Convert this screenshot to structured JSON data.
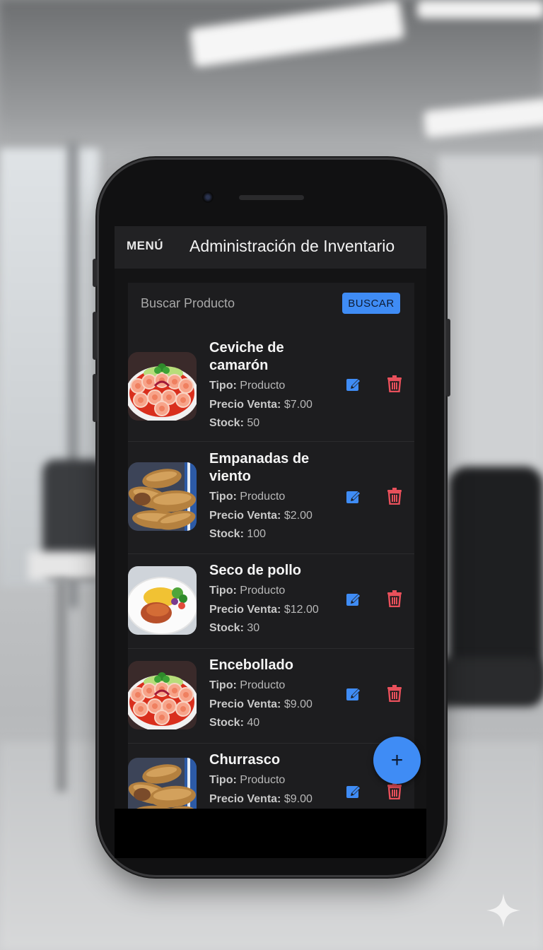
{
  "app": {
    "menu_label": "MENÚ",
    "title": "Administración de Inventario"
  },
  "search": {
    "placeholder": "Buscar Producto",
    "button_label": "BUSCAR"
  },
  "labels": {
    "tipo": "Tipo:",
    "precio": "Precio Venta:",
    "stock": "Stock:"
  },
  "products": [
    {
      "name": "Ceviche de camarón",
      "tipo": "Producto",
      "precio": "$7.00",
      "stock": "50",
      "image": "shrimp-ceviche"
    },
    {
      "name": "Empanadas de viento",
      "tipo": "Producto",
      "precio": "$2.00",
      "stock": "100",
      "image": "empanadas"
    },
    {
      "name": "Seco de pollo",
      "tipo": "Producto",
      "precio": "$12.00",
      "stock": "30",
      "image": "chicken-rice"
    },
    {
      "name": "Encebollado",
      "tipo": "Producto",
      "precio": "$9.00",
      "stock": "40",
      "image": "shrimp-ceviche"
    },
    {
      "name": "Churrasco",
      "tipo": "Producto",
      "precio": "$9.00",
      "stock": "",
      "image": "empanadas"
    }
  ],
  "fab_label": "+",
  "colors": {
    "accent": "#3f8cf5",
    "delete": "#e8505b",
    "appbar": "#222224",
    "panel": "#1d1d1f"
  },
  "icons": [
    "edit-icon",
    "trash-icon",
    "plus-icon"
  ]
}
